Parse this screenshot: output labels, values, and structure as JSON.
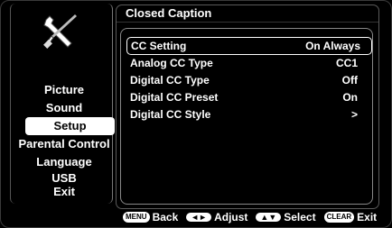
{
  "sidebar": {
    "icon": "tools-icon",
    "items": [
      {
        "label": "Picture"
      },
      {
        "label": "Sound"
      },
      {
        "label": "Setup",
        "selected": true
      },
      {
        "label": "Parental Control"
      },
      {
        "label": "Language"
      },
      {
        "label": "USB"
      },
      {
        "label": "Exit"
      }
    ]
  },
  "main": {
    "title": "Closed Caption",
    "rows": [
      {
        "label": "CC Setting",
        "value": "On Always",
        "active": true
      },
      {
        "label": "Analog CC Type",
        "value": "CC1"
      },
      {
        "label": "Digital CC Type",
        "value": "Off"
      },
      {
        "label": "Digital CC Preset",
        "value": "On"
      },
      {
        "label": "Digital CC Style",
        "value": ">"
      }
    ]
  },
  "footer": {
    "menu_key": "MENU",
    "back": "Back",
    "adjust_key": "◄►",
    "adjust": "Adjust",
    "select_key": "▲▼",
    "select": "Select",
    "clear_key": "CLEAR",
    "exit": "Exit"
  },
  "colors": {
    "background": "#000000",
    "text": "#ffffff",
    "highlight": "#ffffff"
  }
}
